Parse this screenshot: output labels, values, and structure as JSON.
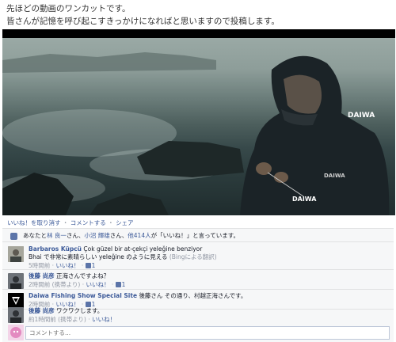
{
  "post": {
    "line1": "先ほどの動画のワンカットです。",
    "line2": "皆さんが記憶を呼び起こすきっかけになればと思いますので投稿します。"
  },
  "actions": {
    "unlike": "いいね！を取り消す",
    "comment": "コメントする",
    "share": "シェア",
    "separator": "・"
  },
  "likes": {
    "prefix": "あなたと",
    "name1": "林 良一",
    "mid1": "さん、",
    "name2": "小沼 輝雄",
    "mid2": "さん、",
    "others": "他414人",
    "suffix": "が「いいね！」と言っています。"
  },
  "comments": [
    {
      "author": "Barbaros Küpcü",
      "text": "Çok güzel bir at-çekçi yeleğine benziyor",
      "translated": "Bhai で非常に素晴らしい yeleğine のように見える",
      "translation_note": "(Bingによる翻訳)",
      "time": "5時間前",
      "like_label": "いいね！",
      "like_count": "1"
    },
    {
      "author": "後藤 尚彦",
      "text": "正海さんですよね？",
      "time": "2時間前 (携帯より)",
      "like_label": "いいね！",
      "like_count": "1"
    },
    {
      "author": "Daiwa Fishing Show Special Site",
      "text": "後藤さん その通り、村越正海さんです。",
      "time": "2時間前",
      "like_label": "いいね！",
      "like_count": "1"
    },
    {
      "author": "後藤 尚彦",
      "text": "ワクワクします。",
      "time": "約1時間前 (携帯より)",
      "like_label": "いいね！"
    }
  ],
  "comment_input": {
    "placeholder": "コメントする..."
  },
  "colors": {
    "link": "#3b5998",
    "meta": "#9197a3",
    "feedback_bg": "#f6f7f8"
  }
}
